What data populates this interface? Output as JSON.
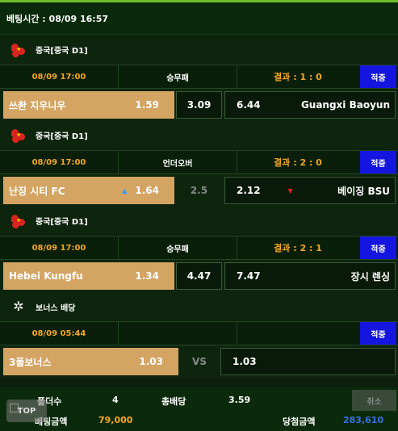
{
  "header": {
    "bet_time_label": "베팅시간 : 08/09 16:57"
  },
  "games": [
    {
      "league": "중국[중국 D1]",
      "time": "08/09 17:00",
      "market": "승무패",
      "result": "결과 : 1 : 0",
      "hit": "적중",
      "home": "쓰촨 지우니우",
      "home_odds": "1.59",
      "middle": "3.09",
      "away_odds": "6.44",
      "away": "Guangxi Baoyun"
    },
    {
      "league": "중국[중국 D1]",
      "time": "08/09 17:00",
      "market": "언더오버",
      "result": "결과 : 2 : 0",
      "hit": "적중",
      "home": "난징 시티 FC",
      "home_odds": "1.64",
      "middle": "2.5",
      "away_odds": "2.12",
      "away": "베이징 BSU"
    },
    {
      "league": "중국[중국 D1]",
      "time": "08/09 17:00",
      "market": "승무패",
      "result": "결과 : 2 : 1",
      "hit": "적중",
      "home": "Hebei Kungfu",
      "home_odds": "1.34",
      "middle": "4.47",
      "away_odds": "7.47",
      "away": "장시 렌싱"
    }
  ],
  "bonus": {
    "label": "보너스 배당",
    "time": "08/09 05:44",
    "hit": "적중",
    "name": "3폴보너스",
    "odds": "1.03",
    "vs": "VS",
    "away_odds": "1.03"
  },
  "footer": {
    "folders_label": "폴더수",
    "folders": "4",
    "total_odds_label": "총배당",
    "total_odds": "3.59",
    "cancel": "취소",
    "bet_amount_label": "베팅금액",
    "bet_amount": "79,000",
    "win_amount_label": "당첨금액",
    "win_amount": "283,610",
    "top": "TOP"
  },
  "colors": {
    "accent_orange": "#f5a623",
    "hit_blue": "#1515e0",
    "selected_tan": "#d4a463",
    "win_blue": "#3a6fe0"
  }
}
